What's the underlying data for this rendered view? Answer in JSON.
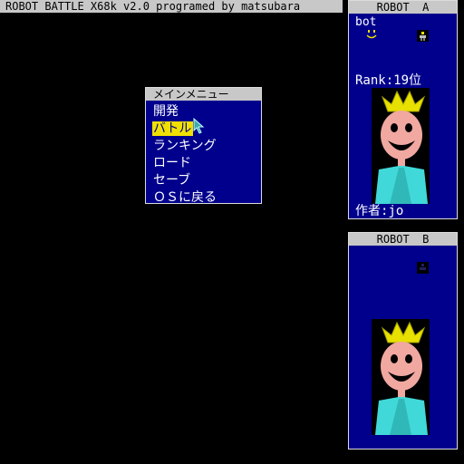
{
  "title_bar": {
    "text": "ROBOT BATTLE X68k v2.0 programed by matsubara"
  },
  "robot_a": {
    "header": "ROBOT  A",
    "bot_name": "bot",
    "rank": "Rank:19位",
    "author": "作者:jo",
    "icon": "fighter-sprite-icon",
    "portrait": "crowned-smiley-portrait"
  },
  "robot_b": {
    "header": "ROBOT  B",
    "icon": "fighter-sprite-icon",
    "portrait": "crowned-smiley-portrait"
  },
  "menu": {
    "title": "メインメニュー",
    "items": [
      {
        "label": "開発",
        "selected": false
      },
      {
        "label": "バトル",
        "selected": true
      },
      {
        "label": "ランキング",
        "selected": false
      },
      {
        "label": "ロード",
        "selected": false
      },
      {
        "label": "セーブ",
        "selected": false
      },
      {
        "label": "ＯＳに戻る",
        "selected": false
      }
    ]
  },
  "colors": {
    "panel_bg": "#00008c",
    "header_bg": "#c8c8c8",
    "highlight": "#f0e000",
    "crown": "#e8e000",
    "face": "#f0a8a0",
    "body": "#40d8d8"
  }
}
